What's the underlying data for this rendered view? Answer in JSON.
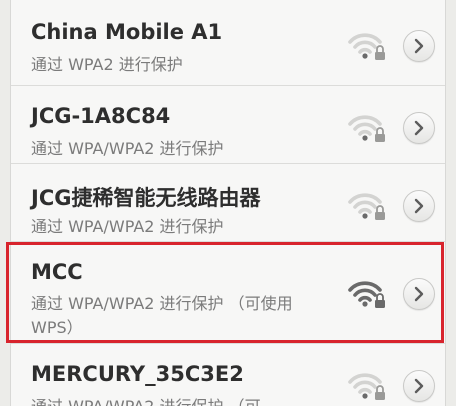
{
  "networks": [
    {
      "ssid": "China Mobile A1",
      "security": "通过 WPA2 进行保护",
      "signal_strength": 0.4
    },
    {
      "ssid": "JCG-1A8C84",
      "security": "通过 WPA/WPA2 进行保护",
      "signal_strength": 0.4
    },
    {
      "ssid": "JCG捷稀智能无线路由器",
      "security": "通过 WPA/WPA2 进行保护",
      "signal_strength": 0.4
    },
    {
      "ssid": "MCC",
      "security": "通过 WPA/WPA2 进行保护 （可使用 WPS）",
      "signal_strength": 1.0,
      "highlighted": true
    },
    {
      "ssid": "MERCURY_35C3E2",
      "security": "通过 WPA/WPA2 进行保护 （可",
      "signal_strength": 0.4
    }
  ],
  "colors": {
    "highlight_border": "#d8242d",
    "signal_strong": "#6a6a6a",
    "signal_weak": "#d3d3d1",
    "ssid_text": "#2e2e2e",
    "secondary_text": "#7b7b7b"
  },
  "icons": {
    "signal": "wifi-lock-icon",
    "detail": "chevron-right-icon"
  }
}
